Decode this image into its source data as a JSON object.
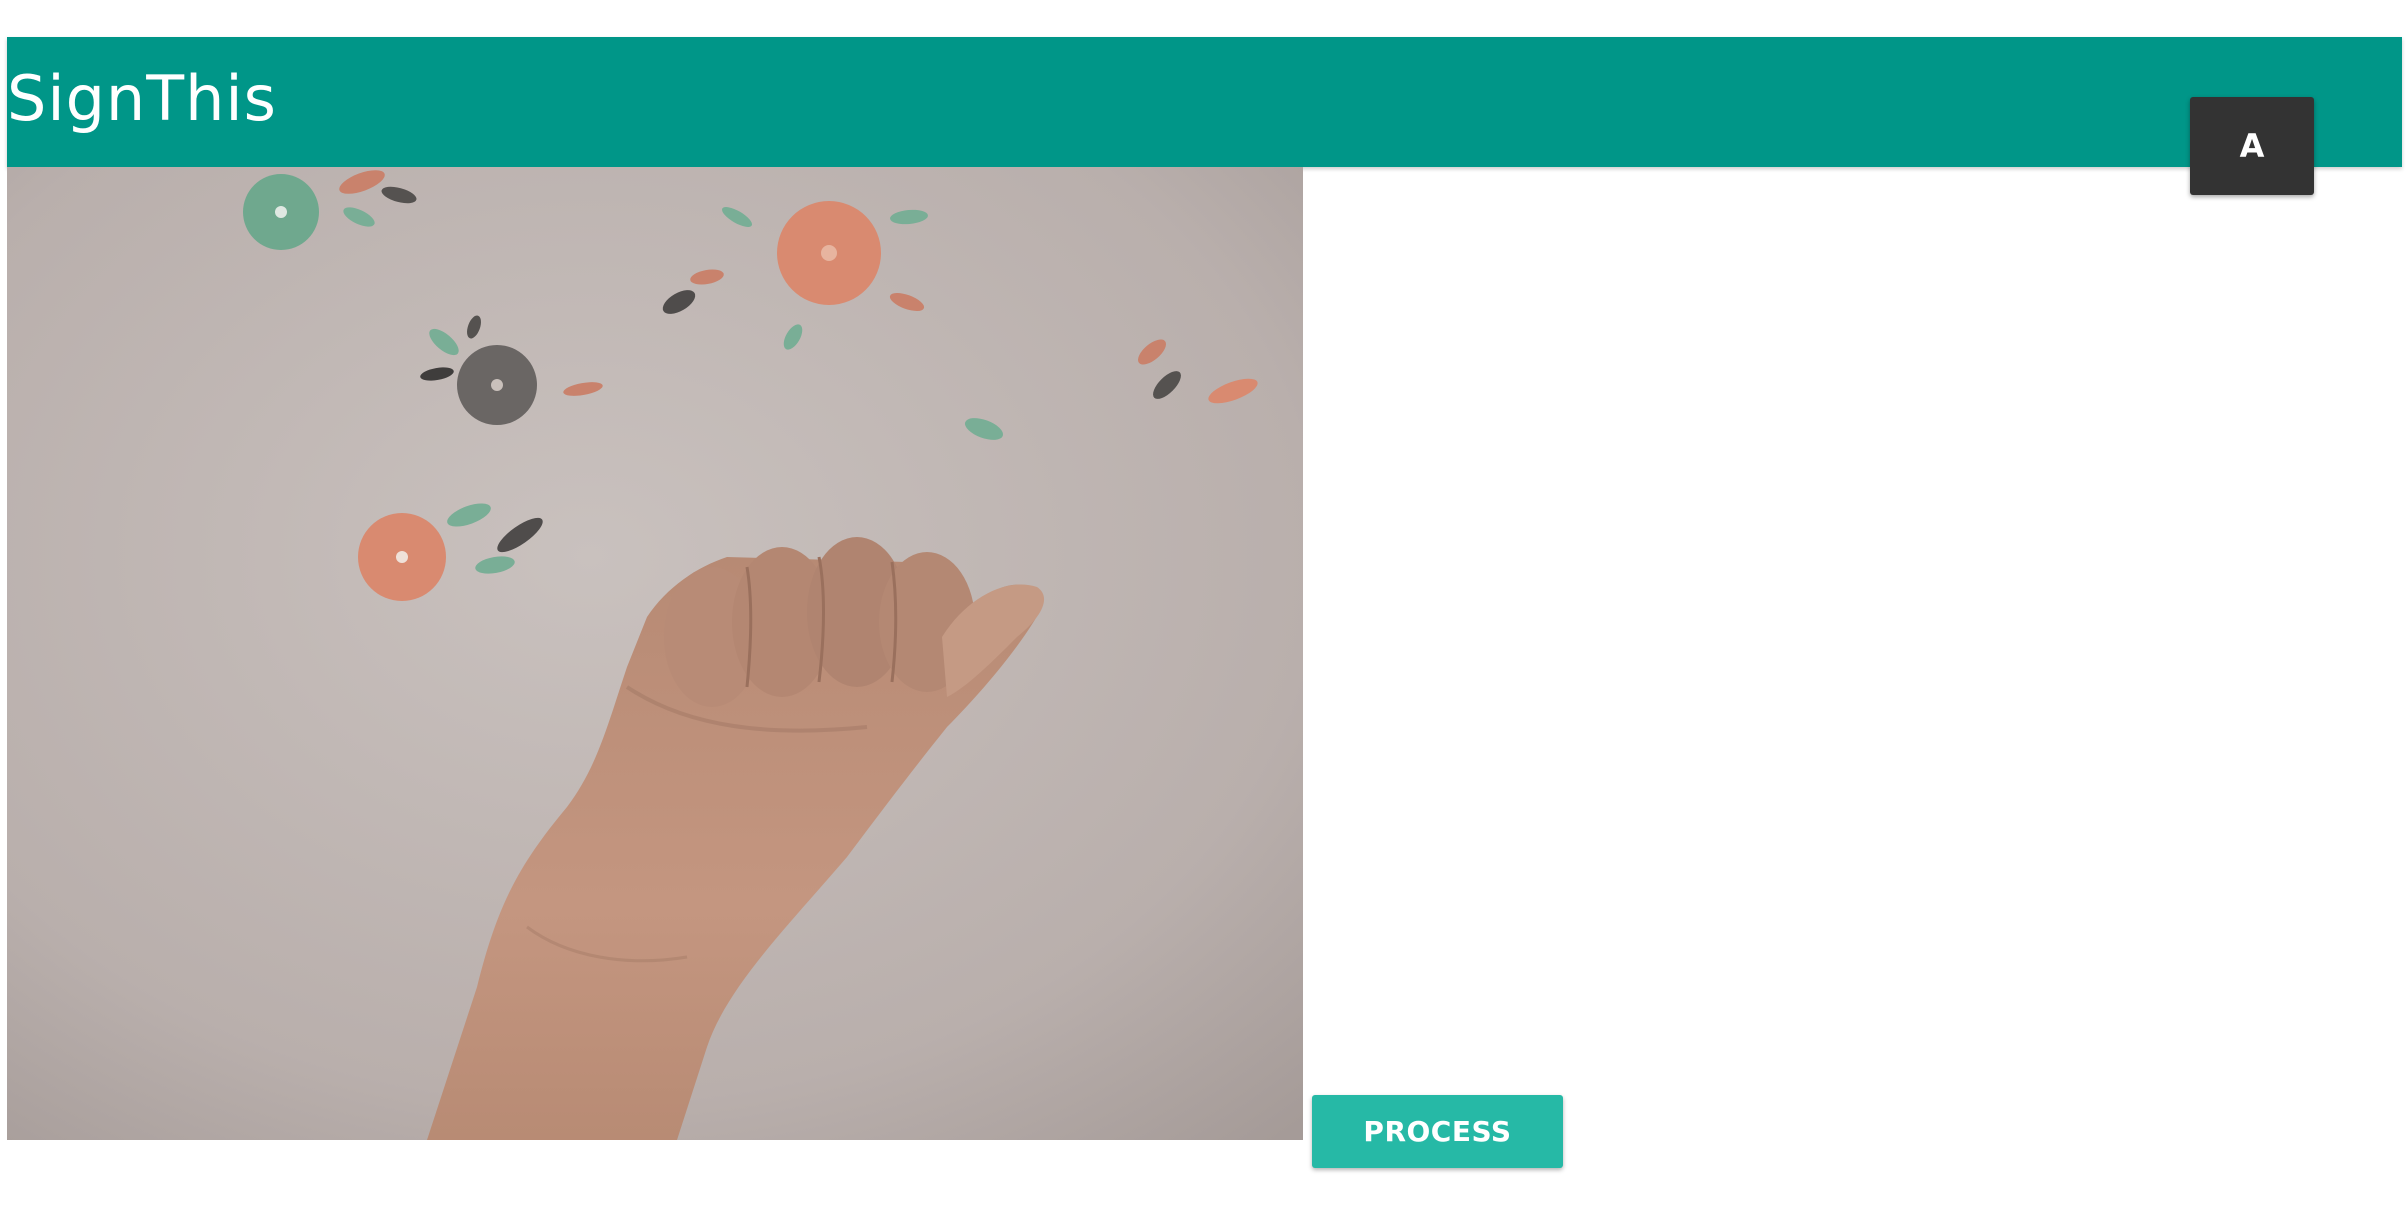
{
  "app": {
    "title": "SignThis"
  },
  "prediction": {
    "letter": "A"
  },
  "camera": {
    "subject": "hand-sign-a"
  },
  "actions": {
    "process_label": "PROCESS"
  },
  "colors": {
    "app_bar": "#009688",
    "process_button": "#26b9a6",
    "letter_chip": "#333333"
  }
}
